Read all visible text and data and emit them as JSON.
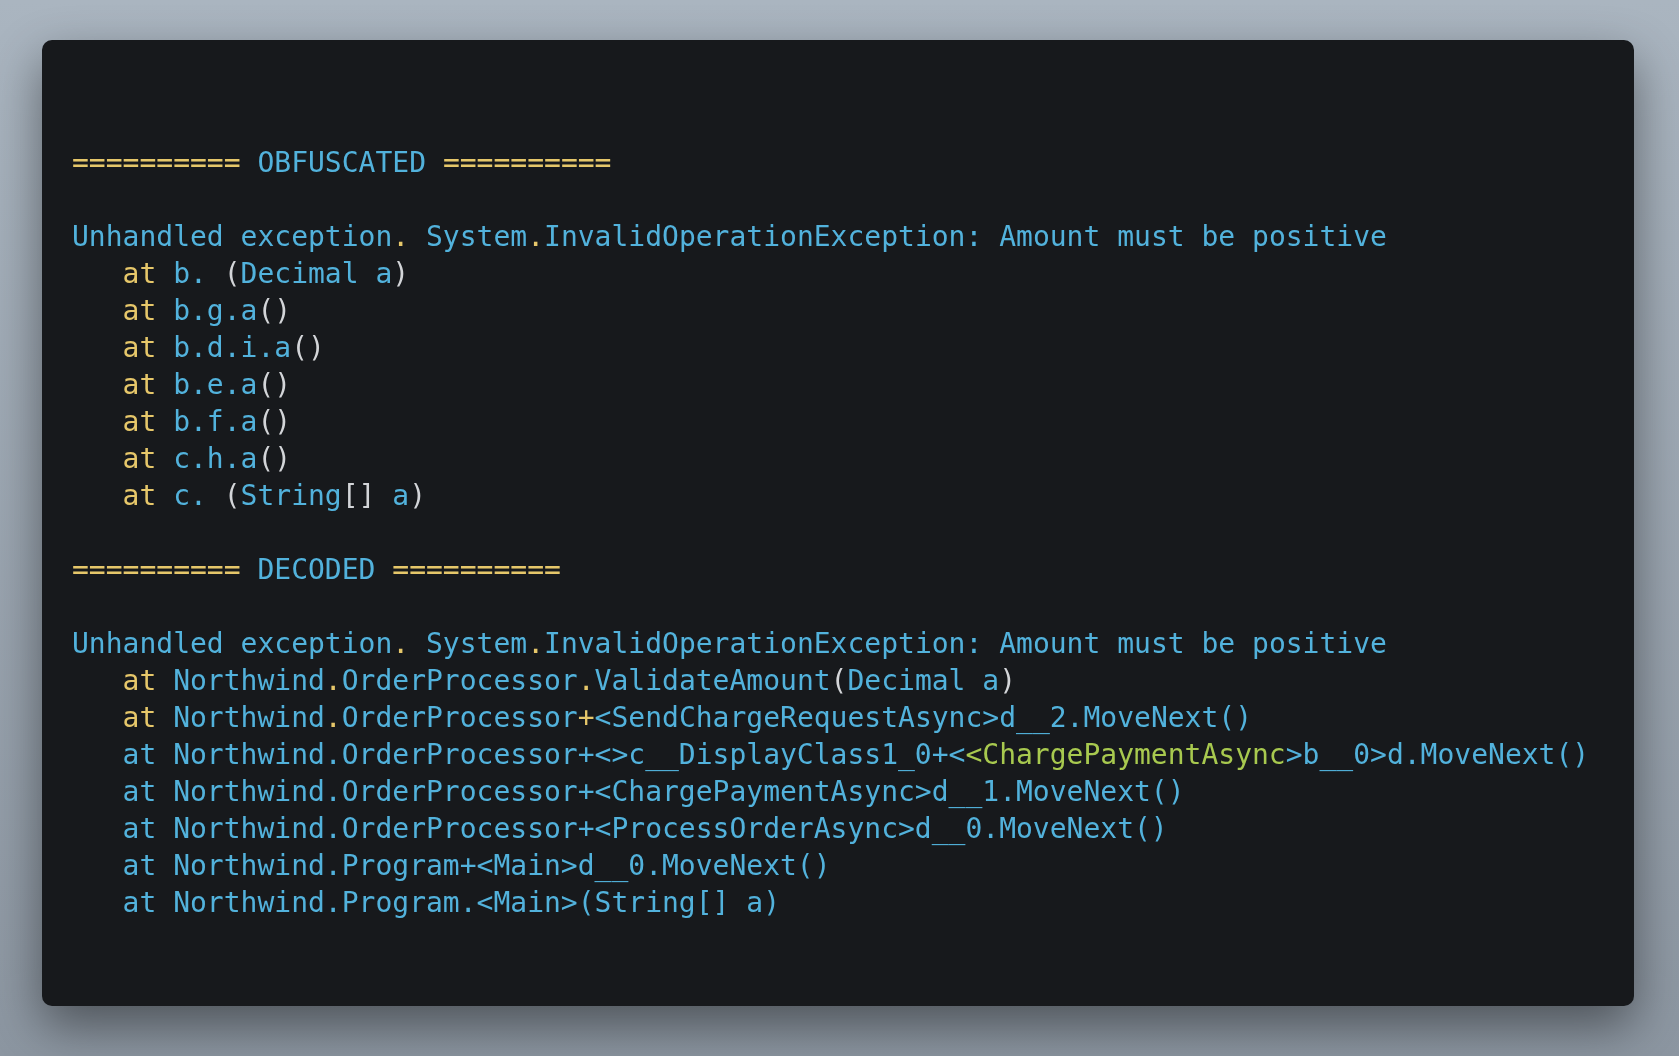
{
  "sections": [
    {
      "header": [
        {
          "text": "==========",
          "kind": "accent"
        },
        {
          "text": " OBFUSCATED ",
          "kind": "plain"
        },
        {
          "text": "==========",
          "kind": "accent"
        }
      ],
      "exception": [
        {
          "text": "Unhandled exception",
          "kind": "plain"
        },
        {
          "text": ".",
          "kind": "accent"
        },
        {
          "text": " System",
          "kind": "plain"
        },
        {
          "text": ".",
          "kind": "accent"
        },
        {
          "text": "InvalidOperationException: Amount must be positive",
          "kind": "plain"
        }
      ],
      "frames": [
        {
          "segments": [
            {
              "text": "at",
              "kind": "accent"
            },
            {
              "text": " b. ",
              "kind": "plain"
            },
            {
              "text": "(",
              "kind": "punct"
            },
            {
              "text": "Decimal a",
              "kind": "plain"
            },
            {
              "text": ")",
              "kind": "punct"
            }
          ]
        },
        {
          "segments": [
            {
              "text": "at",
              "kind": "accent"
            },
            {
              "text": " b.g.a",
              "kind": "plain"
            },
            {
              "text": "()",
              "kind": "punct"
            }
          ]
        },
        {
          "segments": [
            {
              "text": "at",
              "kind": "accent"
            },
            {
              "text": " b.d.i.a",
              "kind": "plain"
            },
            {
              "text": "()",
              "kind": "punct"
            }
          ]
        },
        {
          "segments": [
            {
              "text": "at",
              "kind": "accent"
            },
            {
              "text": " b.e.a",
              "kind": "plain"
            },
            {
              "text": "()",
              "kind": "punct"
            }
          ]
        },
        {
          "segments": [
            {
              "text": "at",
              "kind": "accent"
            },
            {
              "text": " b.f.a",
              "kind": "plain"
            },
            {
              "text": "()",
              "kind": "punct"
            }
          ]
        },
        {
          "segments": [
            {
              "text": "at",
              "kind": "accent"
            },
            {
              "text": " c.h.a",
              "kind": "plain"
            },
            {
              "text": "()",
              "kind": "punct"
            }
          ]
        },
        {
          "segments": [
            {
              "text": "at",
              "kind": "accent"
            },
            {
              "text": " c. ",
              "kind": "plain"
            },
            {
              "text": "(",
              "kind": "punct"
            },
            {
              "text": "String",
              "kind": "plain"
            },
            {
              "text": "[]",
              "kind": "punct"
            },
            {
              "text": " a",
              "kind": "plain"
            },
            {
              "text": ")",
              "kind": "punct"
            }
          ]
        }
      ]
    },
    {
      "header": [
        {
          "text": "==========",
          "kind": "accent"
        },
        {
          "text": " DECODED ",
          "kind": "plain"
        },
        {
          "text": "==========",
          "kind": "accent"
        }
      ],
      "exception": [
        {
          "text": "Unhandled exception",
          "kind": "plain"
        },
        {
          "text": ".",
          "kind": "accent"
        },
        {
          "text": " System",
          "kind": "plain"
        },
        {
          "text": ".",
          "kind": "accent"
        },
        {
          "text": "InvalidOperationException: Amount must be positive",
          "kind": "plain"
        }
      ],
      "frames": [
        {
          "segments": [
            {
              "text": "at",
              "kind": "accent"
            },
            {
              "text": " Northwind",
              "kind": "plain"
            },
            {
              "text": ".",
              "kind": "accent"
            },
            {
              "text": "OrderProcessor",
              "kind": "plain"
            },
            {
              "text": ".",
              "kind": "accent"
            },
            {
              "text": "ValidateAmount",
              "kind": "plain"
            },
            {
              "text": "(",
              "kind": "punct"
            },
            {
              "text": "Decimal a",
              "kind": "plain"
            },
            {
              "text": ")",
              "kind": "punct"
            }
          ]
        },
        {
          "segments": [
            {
              "text": "at",
              "kind": "accent"
            },
            {
              "text": " Northwind",
              "kind": "plain"
            },
            {
              "text": ".",
              "kind": "accent"
            },
            {
              "text": "OrderProcessor",
              "kind": "plain"
            },
            {
              "text": "+",
              "kind": "accent"
            },
            {
              "text": "<SendChargeRequestAsync>d__2.MoveNext()",
              "kind": "plain"
            }
          ]
        },
        {
          "segments": [
            {
              "text": "at Northwind.OrderProcessor+<>c__DisplayClass1_0+<",
              "kind": "plain"
            },
            {
              "text": "<ChargePaymentAsync",
              "kind": "highlight"
            },
            {
              "text": ">b__0>d.MoveNext()",
              "kind": "plain"
            }
          ]
        },
        {
          "segments": [
            {
              "text": "at Northwind.OrderProcessor+<ChargePaymentAsync>d__1.MoveNext()",
              "kind": "plain"
            }
          ]
        },
        {
          "segments": [
            {
              "text": "at Northwind.OrderProcessor+<ProcessOrderAsync>d__0.MoveNext()",
              "kind": "plain"
            }
          ]
        },
        {
          "segments": [
            {
              "text": "at Northwind.Program+<Main>d__0.MoveNext()",
              "kind": "plain"
            }
          ]
        },
        {
          "segments": [
            {
              "text": "at Northwind.Program.<Main>(String[] a)",
              "kind": "plain"
            }
          ]
        }
      ]
    }
  ]
}
